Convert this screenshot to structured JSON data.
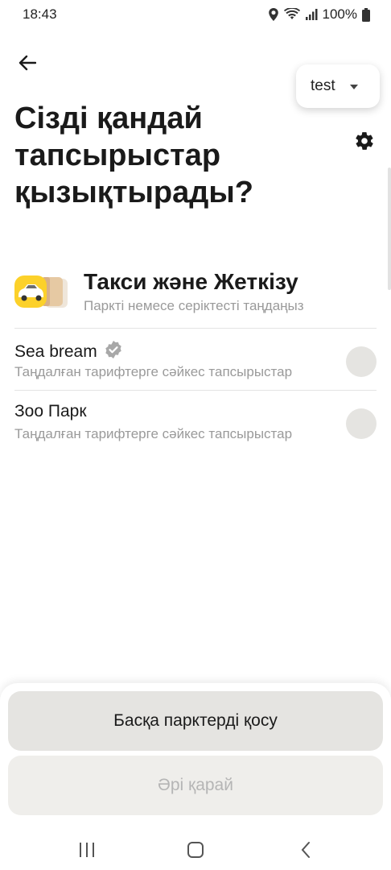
{
  "status_bar": {
    "time": "18:43",
    "battery": "100%",
    "icons": [
      "location-icon",
      "wifi-icon",
      "signal-icon",
      "battery-icon"
    ]
  },
  "header": {
    "park_selector": {
      "label": "test"
    },
    "icons": [
      "back-arrow-icon",
      "dropdown-caret-icon",
      "gear-icon"
    ]
  },
  "title": "Сізді қандай тапсырыстар қызықтырады?",
  "category": {
    "title": "Такси және Жеткізу",
    "subtitle": "Паркті немесе серіктесті таңдаңыз",
    "icon": "taxi-delivery-icon"
  },
  "parks": [
    {
      "name": "Sea bream",
      "verified": true,
      "description": "Таңдалған тарифтерге сәйкес тапсырыстар",
      "selected": false
    },
    {
      "name": "Зоо Парк",
      "verified": false,
      "description": "Таңдалған тарифтерге сәйкес тапсырыстар",
      "selected": false
    }
  ],
  "buttons": {
    "add_parks": "Басқа парктерді қосу",
    "next": "Әрі қарай"
  },
  "nav_bar": {
    "icons": [
      "recent-apps-icon",
      "home-icon",
      "back-icon"
    ]
  },
  "colors": {
    "taxi_yellow": "#fcd12a",
    "button_bg": "#e5e4e1",
    "disabled_text": "#b5b5b5",
    "secondary_text": "#9a9a9a",
    "verified_badge": "#a8a8a8"
  }
}
